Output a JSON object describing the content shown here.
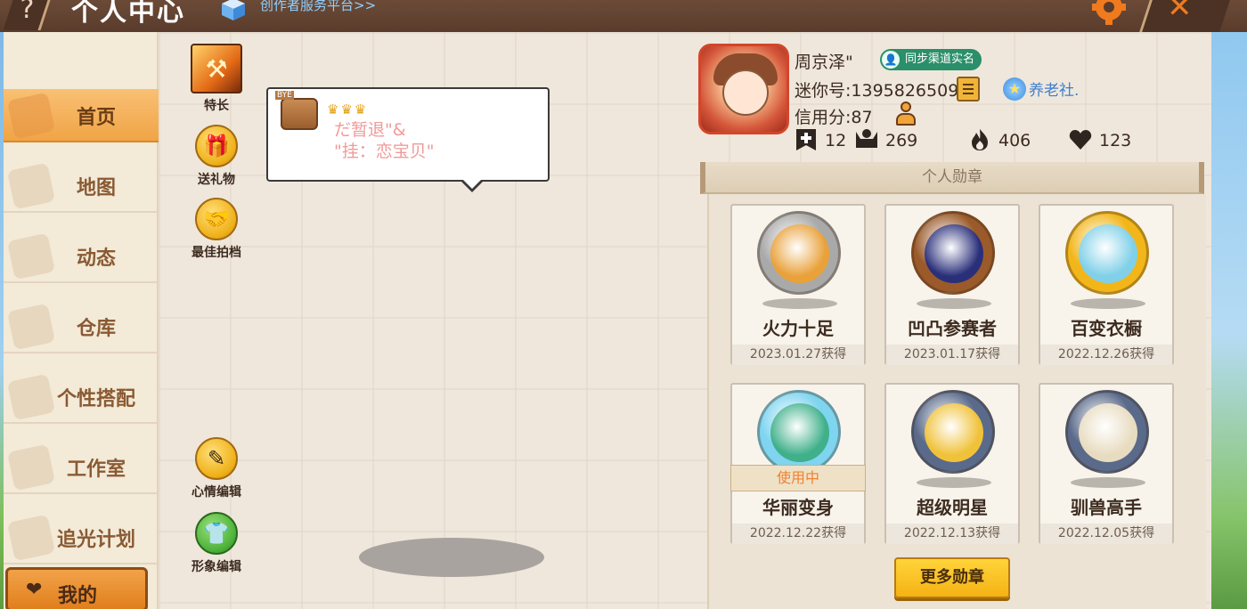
{
  "topbar": {
    "help_icon": "?",
    "title": "个人中心",
    "creator_link": "创作者服务平台>>",
    "close_icon": "✕"
  },
  "sidebar": {
    "items": [
      {
        "label": "首页",
        "active": true
      },
      {
        "label": "地图",
        "active": false
      },
      {
        "label": "动态",
        "active": false
      },
      {
        "label": "仓库",
        "active": false
      },
      {
        "label": "个性搭配",
        "active": false
      },
      {
        "label": "工作室",
        "active": false
      },
      {
        "label": "追光计划",
        "active": false
      }
    ],
    "mine": {
      "label": "我的",
      "icon": "heart-icon"
    }
  },
  "actions": {
    "specialty": "特长",
    "gift": "送礼物",
    "partner": "最佳拍档",
    "mood_edit": "心情编辑",
    "image_edit": "形象编辑"
  },
  "bubble": {
    "tag": "BYE",
    "line1": "だ暂退\"&",
    "line2": "\"挂：恋宝贝\""
  },
  "profile": {
    "name": "周京泽\"",
    "verified_label": "同步渠道实名",
    "id_text": "迷你号:1395826509",
    "org_name": "养老社.",
    "credit_text": "信用分:87",
    "stats": [
      {
        "icon": "bookmark-plus-icon",
        "value": "12"
      },
      {
        "icon": "trophy-person-icon",
        "value": "269"
      },
      {
        "icon": "flame-icon",
        "value": "406"
      },
      {
        "icon": "heart-icon",
        "value": "123"
      }
    ]
  },
  "medals": {
    "header": "个人勋章",
    "items": [
      {
        "name": "火力十足",
        "date": "2023.01.27获得",
        "in_use": false,
        "ring": "#a9a9a9",
        "inner": "#e9a13a"
      },
      {
        "name": "凹凸参赛者",
        "date": "2023.01.17获得",
        "in_use": false,
        "ring": "#9a5a2a",
        "inner": "#2a2f7a"
      },
      {
        "name": "百变衣橱",
        "date": "2022.12.26获得",
        "in_use": false,
        "ring": "#f2b61a",
        "inner": "#7fd0e8"
      },
      {
        "name": "华丽变身",
        "date": "2022.12.22获得",
        "in_use": true,
        "ring": "#7fd4f0",
        "inner": "#3fb08a"
      },
      {
        "name": "超级明星",
        "date": "2022.12.13获得",
        "in_use": false,
        "ring": "#5a6a8a",
        "inner": "#f0c23a"
      },
      {
        "name": "驯兽高手",
        "date": "2022.12.05获得",
        "in_use": false,
        "ring": "#5a6a8a",
        "inner": "#e8dcc0"
      }
    ],
    "in_use_label": "使用中",
    "more_button": "更多勋章"
  },
  "colors": {
    "accent": "#f0a446",
    "topbar": "#5a3c2c",
    "panel": "#f2ebe0"
  }
}
